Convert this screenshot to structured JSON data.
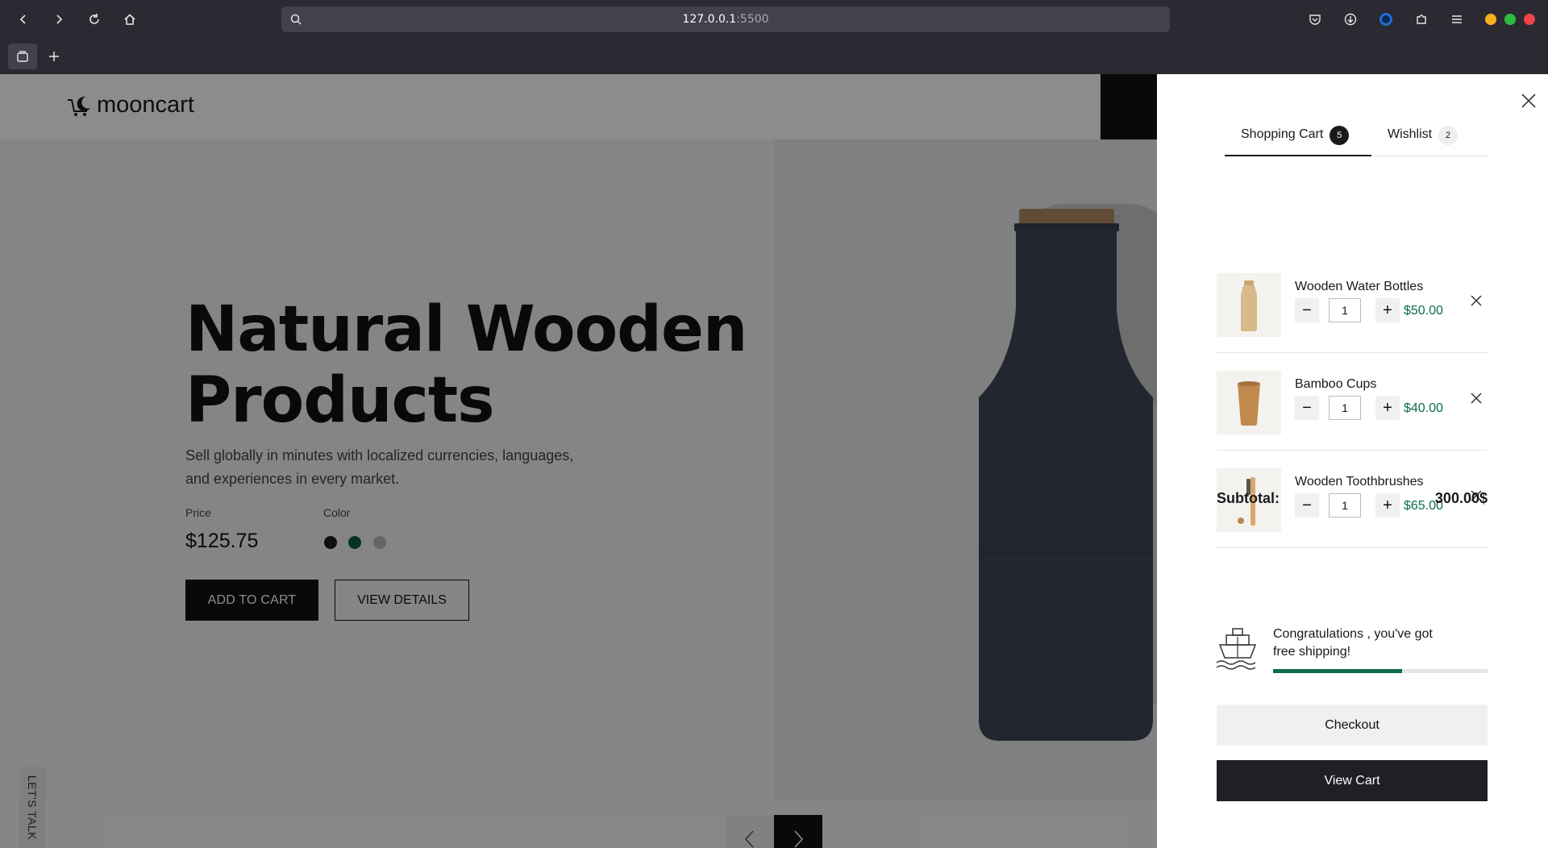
{
  "browser": {
    "url_host": "127.0.0.1",
    "url_port": ":5500",
    "icons": [
      "back-icon",
      "forward-icon",
      "reload-icon",
      "home-icon",
      "search-icon",
      "pocket-icon",
      "download-icon",
      "account-icon",
      "extensions-icon",
      "menu-icon",
      "tab-overview-icon",
      "new-tab-icon"
    ]
  },
  "site": {
    "logo_text": "mooncart"
  },
  "hero": {
    "title_line1": "Natural Wooden",
    "title_line2": "Products",
    "desc_line1": "Sell globally in minutes with localized currencies, languages,",
    "desc_line2": "and experiences in every market.",
    "price_label": "Price",
    "price": "$125.75",
    "color_label": "Color",
    "colors": [
      "#1a1a1a",
      "#0d5b47",
      "#b9b9b9"
    ],
    "add_to_cart": "ADD TO CART",
    "view_details": "VIEW DETAILS",
    "lets_talk": "LET'S TALK"
  },
  "cart": {
    "tabs": [
      {
        "label": "Shopping Cart",
        "count": "5"
      },
      {
        "label": "Wishlist",
        "count": "2"
      }
    ],
    "items": [
      {
        "name": "Wooden Water Bottles",
        "qty": "1",
        "price": "$50.00"
      },
      {
        "name": "Bamboo Cups",
        "qty": "1",
        "price": "$40.00"
      },
      {
        "name": "Wooden Toothbrushes",
        "qty": "1",
        "price": "$65.00"
      }
    ],
    "subtotal_label": "Subtotal:",
    "subtotal_value": "300.00$",
    "shipping_msg": "Congratulations , you've got free shipping!",
    "shipping_progress": 0.6,
    "checkout": "Checkout",
    "view_cart": "View Cart",
    "accent_color": "#0d6b52"
  }
}
